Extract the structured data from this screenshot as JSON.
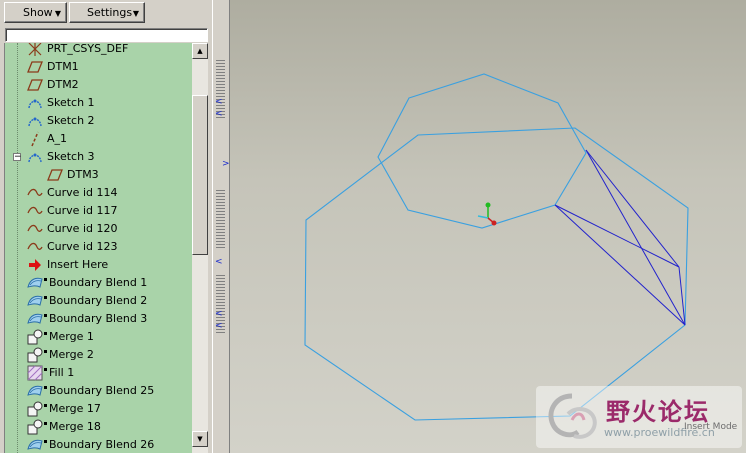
{
  "toolbar": {
    "show_label": "Show",
    "settings_label": "Settings"
  },
  "tree": {
    "items": [
      {
        "label": "PRT_CSYS_DEF",
        "icon": "csys-icon"
      },
      {
        "label": "DTM1",
        "icon": "datum-plane-icon"
      },
      {
        "label": "DTM2",
        "icon": "datum-plane-icon"
      },
      {
        "label": "Sketch 1",
        "icon": "sketch-icon"
      },
      {
        "label": "Sketch 2",
        "icon": "sketch-icon"
      },
      {
        "label": "A_1",
        "icon": "datum-axis-icon"
      },
      {
        "label": "Sketch 3",
        "icon": "sketch-icon"
      },
      {
        "label": "DTM3",
        "icon": "datum-plane-icon"
      },
      {
        "label": "Curve id 114",
        "icon": "curve-icon"
      },
      {
        "label": "Curve id 117",
        "icon": "curve-icon"
      },
      {
        "label": "Curve id 120",
        "icon": "curve-icon"
      },
      {
        "label": "Curve id 123",
        "icon": "curve-icon"
      },
      {
        "label": "Insert Here",
        "icon": "insert-arrow-icon"
      },
      {
        "label": "Boundary Blend 1",
        "icon": "boundary-blend-icon"
      },
      {
        "label": "Boundary Blend 2",
        "icon": "boundary-blend-icon"
      },
      {
        "label": "Boundary Blend 3",
        "icon": "boundary-blend-icon"
      },
      {
        "label": "Merge 1",
        "icon": "merge-icon"
      },
      {
        "label": "Merge 2",
        "icon": "merge-icon"
      },
      {
        "label": "Fill 1",
        "icon": "fill-icon"
      },
      {
        "label": "Boundary Blend 25",
        "icon": "boundary-blend-icon"
      },
      {
        "label": "Merge 17",
        "icon": "merge-icon"
      },
      {
        "label": "Merge 18",
        "icon": "merge-icon"
      },
      {
        "label": "Boundary Blend 26",
        "icon": "boundary-blend-icon"
      }
    ]
  },
  "viewport": {
    "mode_text": "Insert Mode",
    "watermark_title": "野火论坛",
    "watermark_url": "www.proewildfire.cn"
  },
  "colors": {
    "tree_background": "#a9d3a9",
    "curve_color": "#3aa0e0",
    "blend_line_color": "#2222cc"
  }
}
